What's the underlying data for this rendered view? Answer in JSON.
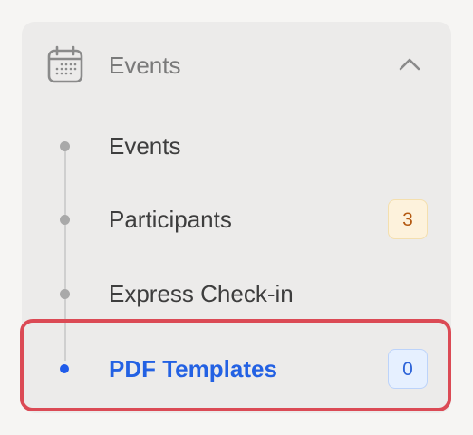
{
  "group": {
    "title": "Events",
    "icon": "calendar-icon",
    "expanded": true
  },
  "items": [
    {
      "label": "Events",
      "badge": null
    },
    {
      "label": "Participants",
      "badge": "3"
    },
    {
      "label": "Express Check-in",
      "badge": null
    },
    {
      "label": "PDF Templates",
      "badge": "0",
      "active": true
    }
  ],
  "colors": {
    "active": "#2361e3",
    "highlight_border": "#db4a55",
    "warn_badge_text": "#b45a12",
    "info_badge_text": "#2e64d8"
  }
}
